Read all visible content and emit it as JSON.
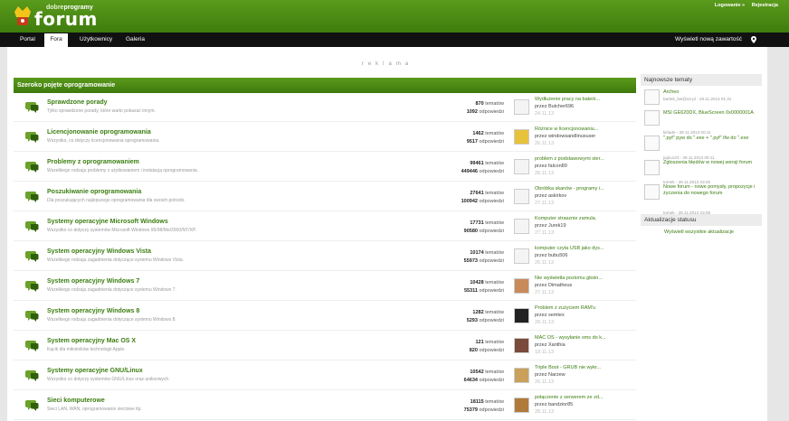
{
  "header": {
    "logo_prefix": "dobre",
    "logo_prefix_bold": "programy",
    "logo_main": "forum",
    "login": "Logowanie »",
    "register": "Rejestracja"
  },
  "nav": {
    "tabs": [
      "Portal",
      "Fora",
      "Użytkownicy",
      "Galeria"
    ],
    "active": "Fora",
    "new_content": "Wyświetl nową zawartość"
  },
  "reklama": "reklama",
  "forum": {
    "header": "Szeroko pojęte oprogramowanie",
    "topics_word": "tematów",
    "replies_word": "odpowiedzi",
    "rows": [
      {
        "title": "Sprawdzone porady",
        "desc": "Tylko sprawdzone porady, które warto pokazać innym.",
        "topics": "870",
        "replies": "1092",
        "last_title": "Wydłużenie pracy na baterii...",
        "last_by": "przez Butcher696",
        "last_date": "24.11.13"
      },
      {
        "title": "Licencjonowanie oprogramowania",
        "desc": "Wszystko, co dotyczy licencjonowania oprogramowania.",
        "topics": "1462",
        "replies": "9517",
        "last_title": "Różnice w licencjonowaniu...",
        "last_by": "przez windowsandlinuxuser",
        "last_date": "26.11.13"
      },
      {
        "title": "Problemy z oprogramowaniem",
        "desc": "Wszelkiego rodzaju problemy z użytkowaniem i instalacją oprogramowania.",
        "topics": "99461",
        "replies": "449446",
        "last_title": "problem z podstawowymi ster...",
        "last_by": "przez falcon89",
        "last_date": "28.11.13"
      },
      {
        "title": "Poszukiwanie oprogramowania",
        "desc": "Dla poszukujących najlepszego oprogramowania dla swoich potrzeb.",
        "topics": "27641",
        "replies": "100942",
        "last_title": "Obróbka skanów - programy i...",
        "last_by": "przez askirkov",
        "last_date": "27.11.13"
      },
      {
        "title": "Systemy operacyjne Microsoft Windows",
        "desc": "Wszystko co dotyczy systemów Microsoft Windows 95/98/Me/2000/NT/XP.",
        "topics": "17731",
        "replies": "90580",
        "last_title": "Komputer strasznie zamula.",
        "last_by": "przez Jurek19",
        "last_date": "27.11.13"
      },
      {
        "title": "System operacyjny Windows Vista",
        "desc": "Wszelkiego rodzaju zagadnienia dotyczące systemu Windows Vista.",
        "topics": "10174",
        "replies": "55973",
        "last_title": "komputer czyta USB jako dys...",
        "last_by": "przez bubu506",
        "last_date": "26.11.13"
      },
      {
        "title": "System operacyjny Windows 7",
        "desc": "Wszelkiego rodzaju zagadnienia dotyczące systemu Windows 7.",
        "topics": "10428",
        "replies": "55311",
        "last_title": "Nie wyświetla poziomu głośn...",
        "last_by": "przez Dimatheus",
        "last_date": "27.11.13"
      },
      {
        "title": "System operacyjny Windows 8",
        "desc": "Wszelkiego rodzaju zagadnienia dotyczące systemu Windows 8.",
        "topics": "1282",
        "replies": "5293",
        "last_title": "Problem z zużyciem RAM'u",
        "last_by": "przez semtex",
        "last_date": "28.11.13"
      },
      {
        "title": "System operacyjny Mac OS X",
        "desc": "Kącik dla miłośników technologii Apple.",
        "topics": "121",
        "replies": "820",
        "last_title": "MAC OS - wysyłanie sms do k...",
        "last_by": "przez Xanthia",
        "last_date": "18.11.13"
      },
      {
        "title": "Systemy operacyjne GNU/Linux",
        "desc": "Wszystko co dotyczy systemów GNU/Linux oraz uniksowych.",
        "topics": "10542",
        "replies": "64634",
        "last_title": "Triple Boot - GRUB nie wykr...",
        "last_by": "przez Narzew",
        "last_date": "26.11.13"
      },
      {
        "title": "Sieci komputerowe",
        "desc": "Sieci LAN, WAN, oprogramowanie sieciowe itp.",
        "topics": "18115",
        "replies": "75379",
        "last_title": "połączenie z serwerem ze zd...",
        "last_by": "przez bandzior85",
        "last_date": "28.11.13"
      }
    ]
  },
  "sidebar": {
    "newest_header": "Najnowsze tematy",
    "topics": [
      {
        "title": "Archeo",
        "meta": "bartek_bw@o2.pl - 28.11.2013 01:31"
      },
      {
        "title": "MSI GE620DX, BlueScreen 0x0000001A",
        "meta": "kirlade - 28.11.2013 00:11"
      },
      {
        "title": "\".pyf\" pyw do \".exe + \".pyf\" ifw do \".exe",
        "meta": "jupiu123 - 28.11.2013 00:11"
      },
      {
        "title": "Zgłoszenia błędów w nowej wersji forum",
        "meta": "tomek - 28.11.2013 23:45"
      },
      {
        "title": "Nowe forum - nowe pomysły, propozycje i życzenia do nowego forum",
        "meta": "tomek - 28.11.2013 23:38"
      }
    ],
    "status_header": "Aktualizacje statusu",
    "status_link": "Wyświetl wszystkie aktualizacje"
  }
}
